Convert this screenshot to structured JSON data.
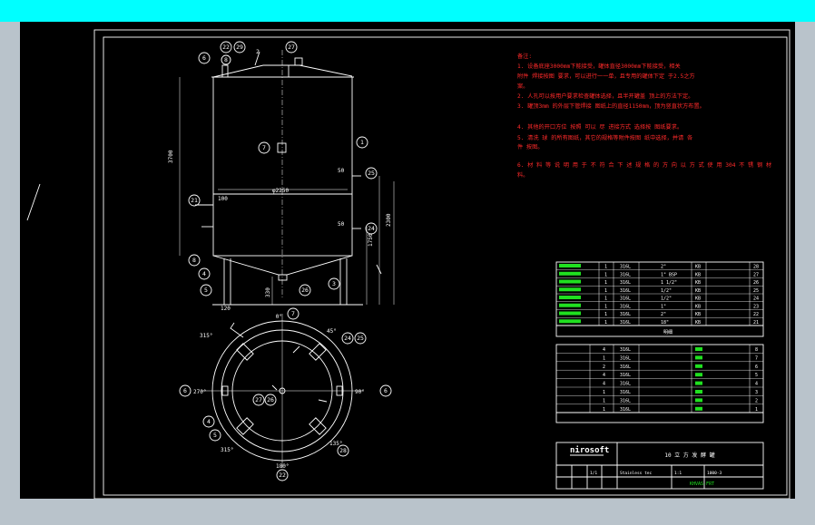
{
  "notes": {
    "heading": "备注:",
    "lines": [
      "1. 设备底座3000mm下能接受，罐体直径3000mm下能接受，相关",
      "附件 焊接按图 要求，可以进行一一单，且专用的罐体下定 于2.5之方",
      "案。",
      "2. 人孔可以按用户要求检查罐体选择，且半开罐盖 顶上的方法下定。",
      "3. 罐顶3mm 的外层下管焊接 图纸上的直径1150mm，顶为竖直状方布置。",
      "4. 其他的开口方位 按照 可以 尽 进接方式 选择按 图纸要求。",
      "5. 清洗 球 的所有图纸，其它的规格等附件按图 纸中选择，并请 各",
      "件 按图。",
      "6. 材 料 等 说 明 用 于 不 符 合 下 述 规 格 的 方 向 以 方 式 使 用 304 不 锈 钢 材",
      "料。"
    ]
  },
  "callouts": [
    "6",
    "22",
    "29",
    "8",
    "27",
    "7",
    "1",
    "25",
    "21",
    "24",
    "8",
    "4",
    "5",
    "26",
    "3",
    "7",
    "24",
    "25",
    "6",
    "6",
    "27",
    "26",
    "4",
    "5",
    "28",
    "22"
  ],
  "angle_labels": [
    "0°",
    "45°",
    "315°",
    "270°",
    "90°",
    "135°",
    "315°",
    "180°"
  ],
  "parts_table": {
    "rows": [
      {
        "qty": "1",
        "mat": "316L",
        "spec": "2\"",
        "std": "KB",
        "no": "28"
      },
      {
        "qty": "1",
        "mat": "316L",
        "spec": "1\" BSP",
        "std": "KB",
        "no": "27"
      },
      {
        "qty": "1",
        "mat": "316L",
        "spec": "1 1/2\"",
        "std": "KB",
        "no": "26"
      },
      {
        "qty": "1",
        "mat": "316L",
        "spec": "1/2\"",
        "std": "KB",
        "no": "25"
      },
      {
        "qty": "1",
        "mat": "316L",
        "spec": "1/2\"",
        "std": "KB",
        "no": "24"
      },
      {
        "qty": "1",
        "mat": "316L",
        "spec": "1\"",
        "std": "KB",
        "no": "23"
      },
      {
        "qty": "1",
        "mat": "316L",
        "spec": "2\"",
        "std": "KB",
        "no": "22"
      },
      {
        "qty": "1",
        "mat": "316L",
        "spec": "18\"",
        "std": "KB",
        "no": "21"
      }
    ],
    "rows2": [
      {
        "qty": "4",
        "mat": "316L",
        "no": "8"
      },
      {
        "qty": "1",
        "mat": "316L",
        "no": "7"
      },
      {
        "qty": "2",
        "mat": "316L",
        "no": "6"
      },
      {
        "qty": "4",
        "mat": "316L",
        "no": "5"
      },
      {
        "qty": "4",
        "mat": "316L",
        "no": "4"
      },
      {
        "qty": "1",
        "mat": "316L",
        "no": "3"
      },
      {
        "qty": "1",
        "mat": "316L",
        "no": "2"
      },
      {
        "qty": "1",
        "mat": "316L",
        "no": "1"
      }
    ]
  },
  "title_block": {
    "logo": "nirosoft",
    "title": "10 立 方 发 酵 罐",
    "material_note": "Stainless tec",
    "scale": "1:1",
    "sheet": "1/1",
    "code": "1000-3",
    "footer": "KHVAS-FRT"
  },
  "colors": {
    "background": "#000000",
    "lines": "#ffffff",
    "notes": "#ff2a2a",
    "dims": "#ff40ff",
    "table_text": "#20e020",
    "top_strip": "#00ffff"
  }
}
